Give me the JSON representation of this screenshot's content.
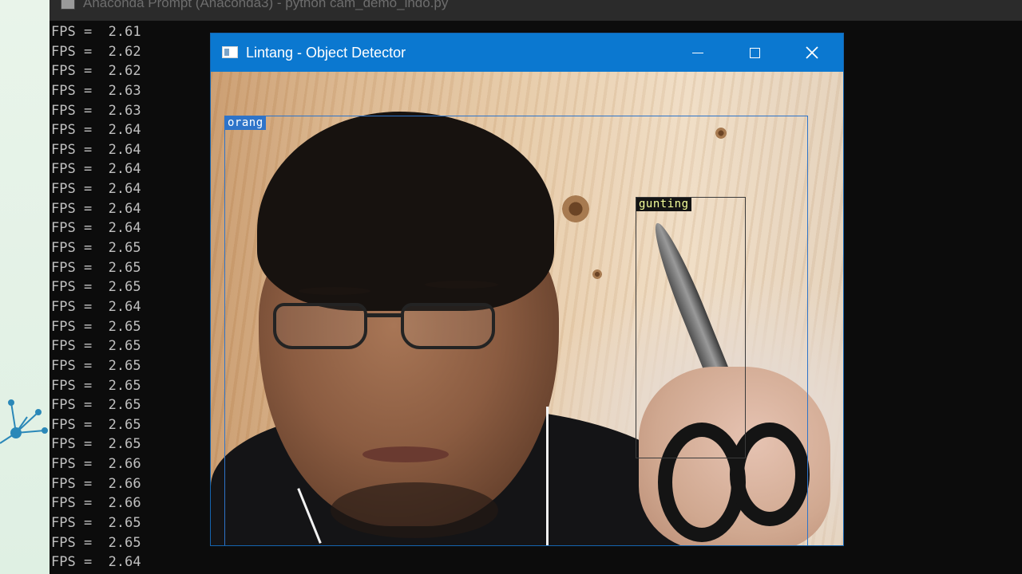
{
  "console": {
    "title": "Anaconda Prompt (Anaconda3) - python  cam_demo_indo.py",
    "fps_label": "FPS =",
    "fps_values": [
      "2.61",
      "2.62",
      "2.62",
      "2.63",
      "2.63",
      "2.64",
      "2.64",
      "2.64",
      "2.64",
      "2.64",
      "2.64",
      "2.65",
      "2.65",
      "2.65",
      "2.64",
      "2.65",
      "2.65",
      "2.65",
      "2.65",
      "2.65",
      "2.65",
      "2.65",
      "2.66",
      "2.66",
      "2.66",
      "2.65",
      "2.65",
      "2.64"
    ]
  },
  "detector_window": {
    "title": "Lintang - Object Detector",
    "minimize_icon": "minimize-icon",
    "maximize_icon": "maximize-icon",
    "close_icon": "close-icon",
    "close_glyph": "✕"
  },
  "detections": [
    {
      "label": "orang",
      "color": "#2e74c9"
    },
    {
      "label": "gunting",
      "color": "#141414"
    }
  ]
}
